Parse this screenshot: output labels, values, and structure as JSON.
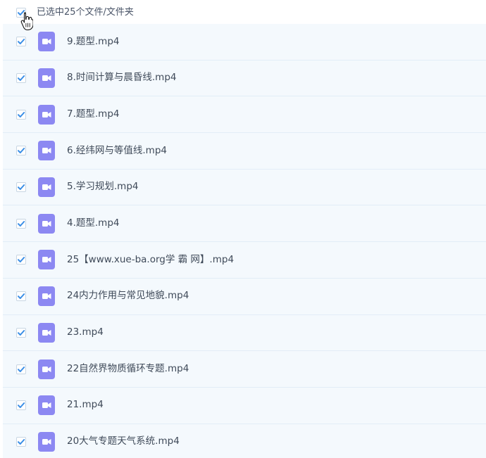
{
  "header": {
    "selection_label": "已选中25个文件/文件夹",
    "checked": true
  },
  "colors": {
    "checkbox_check": "#3a8ee6",
    "file_icon": "#8c88f2",
    "row_bg": "#f4f9fd",
    "row_border": "#e2edf7"
  },
  "icons": {
    "checkbox": "check-icon",
    "file": "video-file-icon",
    "cursor": "hand-pointer-icon"
  },
  "files": [
    {
      "name": "9.题型.mp4",
      "checked": true
    },
    {
      "name": "8.时间计算与晨昏线.mp4",
      "checked": true
    },
    {
      "name": "7.题型.mp4",
      "checked": true
    },
    {
      "name": "6.经纬网与等值线.mp4",
      "checked": true
    },
    {
      "name": "5.学习规划.mp4",
      "checked": true
    },
    {
      "name": "4.题型.mp4",
      "checked": true
    },
    {
      "name": "25【www.xue-ba.org学 霸 网】.mp4",
      "checked": true
    },
    {
      "name": "24内力作用与常见地貌.mp4",
      "checked": true
    },
    {
      "name": "23.mp4",
      "checked": true
    },
    {
      "name": "22自然界物质循环专题.mp4",
      "checked": true
    },
    {
      "name": "21.mp4",
      "checked": true
    },
    {
      "name": "20大气专题天气系统.mp4",
      "checked": true
    }
  ]
}
